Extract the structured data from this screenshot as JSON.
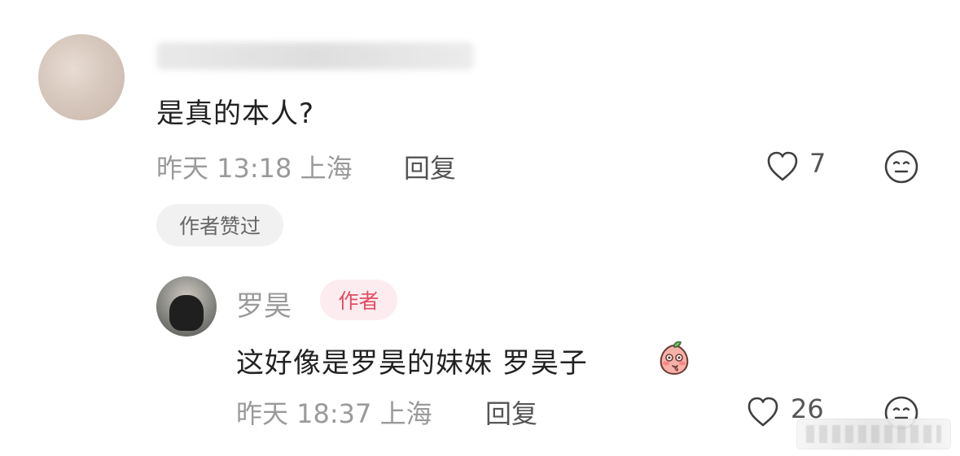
{
  "comments": [
    {
      "text": "是真的本人?",
      "meta": "昨天 13:18 上海",
      "reply_label": "回复",
      "likes": "7",
      "liked_by_author_label": "作者赞过"
    }
  ],
  "reply": {
    "name": "罗昊",
    "author_badge": "作者",
    "text": "这好像是罗昊的妹妹 罗昊子",
    "meta": "昨天 18:37 上海",
    "reply_label": "回复",
    "likes": "26"
  },
  "icons": {
    "like": "heart-icon",
    "dislike": "meh-face-icon",
    "emoji": "peach-blush-emoji-icon"
  },
  "colors": {
    "muted": "#9a9a9a",
    "author_badge_bg": "#fdecef",
    "author_badge_text": "#e24b63"
  }
}
